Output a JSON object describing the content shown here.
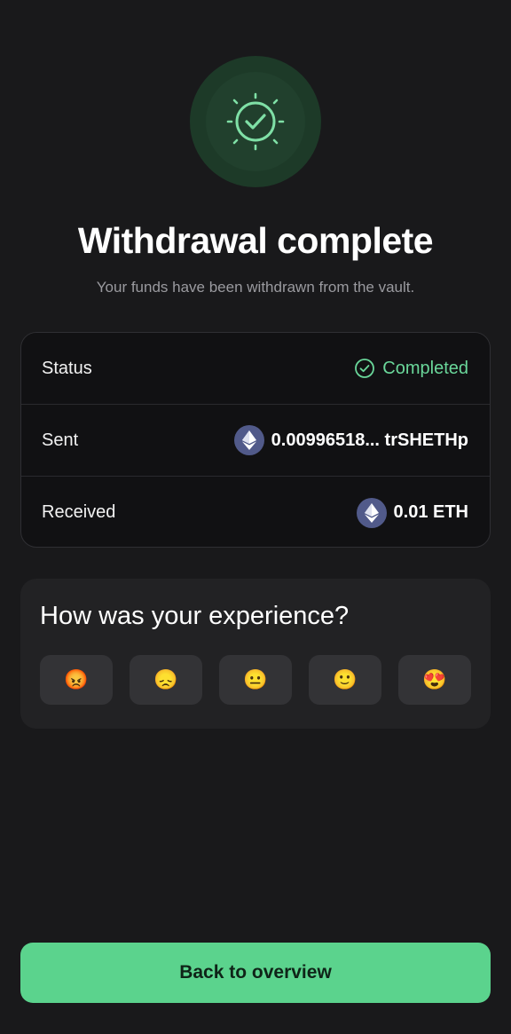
{
  "hero": {
    "icon": "success-check-icon",
    "title": "Withdrawal complete",
    "subtitle": "Your funds have been withdrawn from the vault."
  },
  "details": {
    "status": {
      "label": "Status",
      "value": "Completed",
      "icon": "check-circle-icon"
    },
    "sent": {
      "label": "Sent",
      "value": "0.00996518... trSHETHp",
      "icon": "eth-icon"
    },
    "received": {
      "label": "Received",
      "value": "0.01 ETH",
      "icon": "eth-icon"
    }
  },
  "feedback": {
    "question": "How was your experience?",
    "options": [
      {
        "emoji": "😡",
        "name": "angry"
      },
      {
        "emoji": "😞",
        "name": "disappointed"
      },
      {
        "emoji": "😐",
        "name": "neutral"
      },
      {
        "emoji": "🙂",
        "name": "happy"
      },
      {
        "emoji": "😍",
        "name": "love"
      }
    ]
  },
  "cta": {
    "label": "Back to overview"
  },
  "colors": {
    "background": "#19191b",
    "accent": "#5bd38d",
    "status_green": "#6ad79a",
    "eth_badge": "#515a8a"
  }
}
